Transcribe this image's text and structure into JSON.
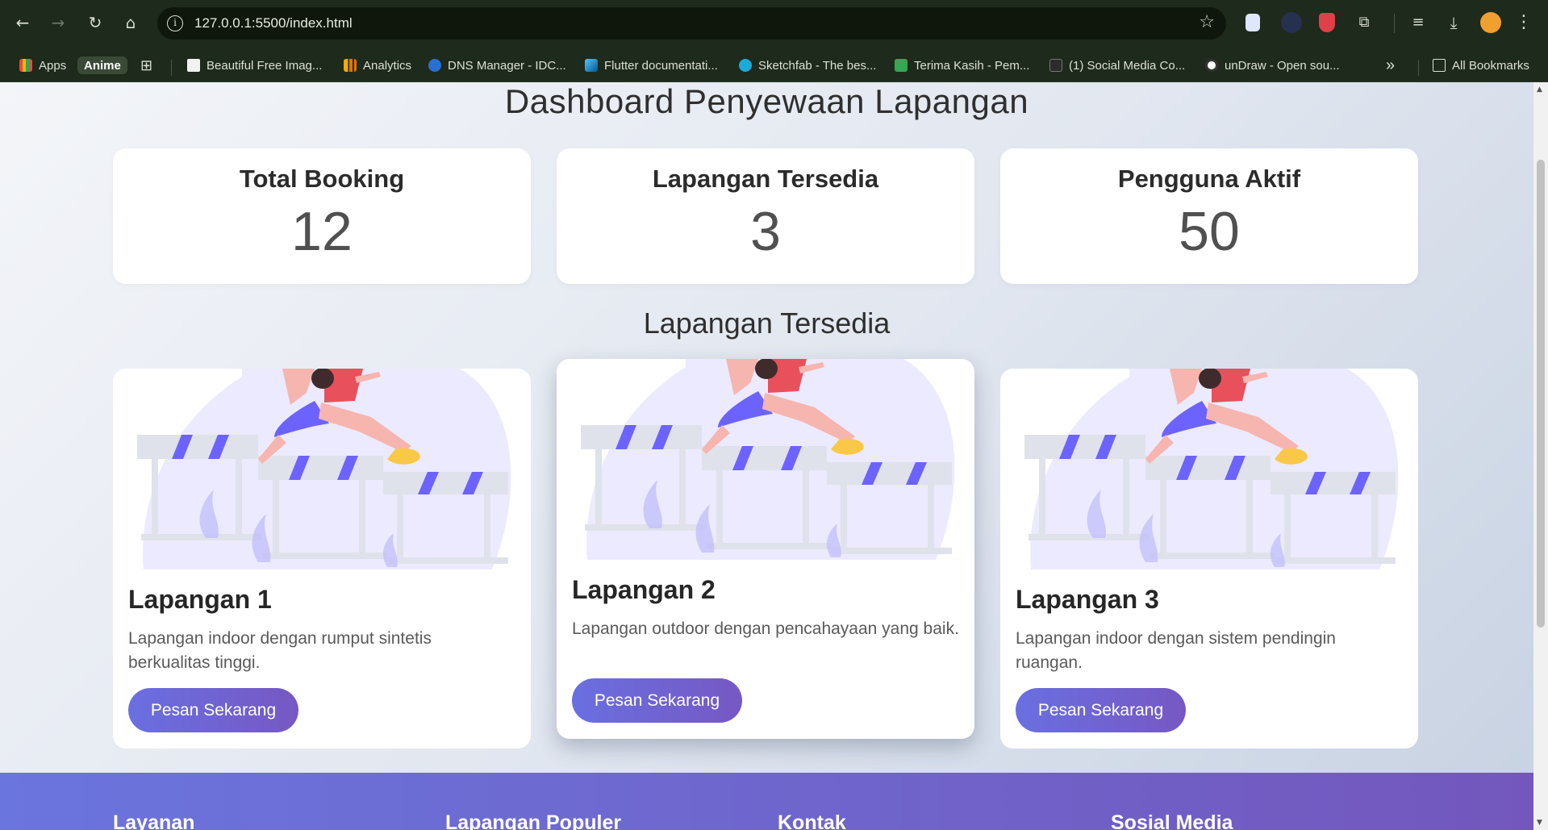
{
  "browser": {
    "url": "127.0.0.1:5500/index.html",
    "bookmarks": [
      "Apps",
      "Anime",
      "Beautiful Free Imag...",
      "Analytics",
      "DNS Manager - IDC...",
      "Flutter documentati...",
      "Sketchfab - The bes...",
      "Terima Kasih - Pem...",
      "(1) Social Media Co...",
      "unDraw - Open sou..."
    ],
    "all_bookmarks": "All Bookmarks",
    "more_icon": "»"
  },
  "page": {
    "title": "Dashboard Penyewaan Lapangan",
    "stats": [
      {
        "label": "Total Booking",
        "value": "12"
      },
      {
        "label": "Lapangan Tersedia",
        "value": "3"
      },
      {
        "label": "Pengguna Aktif",
        "value": "50"
      }
    ],
    "section_title": "Lapangan Tersedia",
    "fields": [
      {
        "name": "Lapangan 1",
        "description": "Lapangan indoor dengan rumput sintetis berkualitas tinggi.",
        "button": "Pesan Sekarang"
      },
      {
        "name": "Lapangan 2",
        "description": "Lapangan outdoor dengan pencahayaan yang baik.",
        "button": "Pesan Sekarang"
      },
      {
        "name": "Lapangan 3",
        "description": "Lapangan indoor dengan sistem pendingin ruangan.",
        "button": "Pesan Sekarang"
      }
    ],
    "footer": {
      "columns": [
        "Layanan",
        "Lapangan Populer",
        "Kontak",
        "Sosial Media"
      ]
    }
  },
  "colors": {
    "button_gradient_start": "#6a6fe0",
    "button_gradient_end": "#7658c4",
    "footer_start": "#6a75dd",
    "footer_end": "#7357bd",
    "hurdle_stripe": "#6c63ff",
    "runner_top": "#e8505b",
    "runner_skin": "#f7b5b0",
    "shoe": "#f9c846"
  }
}
